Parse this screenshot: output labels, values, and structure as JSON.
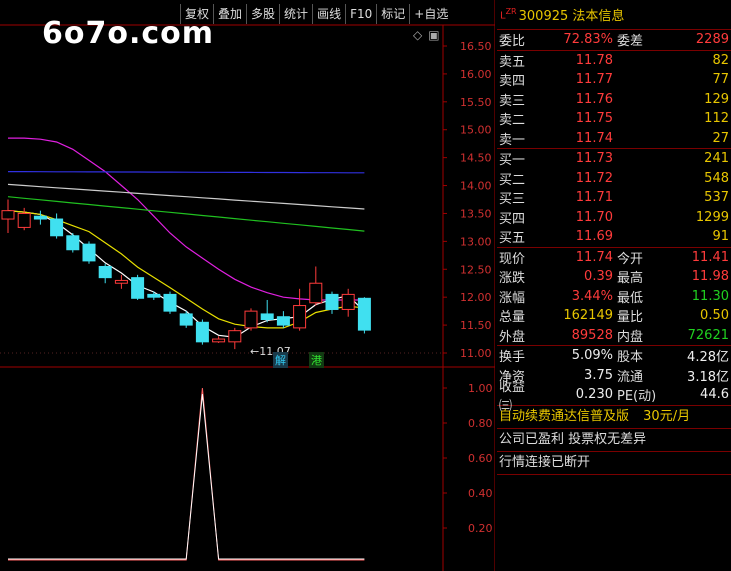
{
  "toolbar": {
    "buttons": [
      "复权",
      "叠加",
      "多股",
      "统计",
      "画线",
      "F10",
      "标记",
      "+自选"
    ]
  },
  "watermark": "6o7o.com",
  "chart": {
    "price_axis": [
      "16.50",
      "16.00",
      "15.50",
      "15.00",
      "14.50",
      "14.00",
      "13.50",
      "13.00",
      "12.50",
      "12.00",
      "11.50",
      "11.00"
    ],
    "indicator_axis": [
      "1.00",
      "0.80",
      "0.60",
      "0.40",
      "0.20"
    ],
    "low_marker": "←11.07",
    "tag_jie": "解",
    "tag_gang": "港"
  },
  "chart_data": {
    "type": "candlestick",
    "ylim": [
      10.9,
      16.6
    ],
    "candles": [
      {
        "o": 13.4,
        "c": 13.55,
        "h": 13.75,
        "l": 13.15
      },
      {
        "o": 13.25,
        "c": 13.5,
        "h": 13.6,
        "l": 13.2
      },
      {
        "o": 13.45,
        "c": 13.4,
        "h": 13.55,
        "l": 13.3
      },
      {
        "o": 13.4,
        "c": 13.1,
        "h": 13.5,
        "l": 13.05
      },
      {
        "o": 13.1,
        "c": 12.85,
        "h": 13.15,
        "l": 12.8
      },
      {
        "o": 12.95,
        "c": 12.65,
        "h": 13.0,
        "l": 12.6
      },
      {
        "o": 12.55,
        "c": 12.35,
        "h": 12.6,
        "l": 12.25
      },
      {
        "o": 12.25,
        "c": 12.3,
        "h": 12.4,
        "l": 12.15
      },
      {
        "o": 12.35,
        "c": 11.98,
        "h": 12.4,
        "l": 11.95
      },
      {
        "o": 12.05,
        "c": 12.0,
        "h": 12.1,
        "l": 11.95
      },
      {
        "o": 12.05,
        "c": 11.75,
        "h": 12.1,
        "l": 11.7
      },
      {
        "o": 11.7,
        "c": 11.5,
        "h": 11.75,
        "l": 11.45
      },
      {
        "o": 11.55,
        "c": 11.2,
        "h": 11.6,
        "l": 11.15
      },
      {
        "o": 11.2,
        "c": 11.25,
        "h": 11.3,
        "l": 11.18
      },
      {
        "o": 11.2,
        "c": 11.4,
        "h": 11.45,
        "l": 11.07
      },
      {
        "o": 11.45,
        "c": 11.75,
        "h": 11.8,
        "l": 11.4
      },
      {
        "o": 11.7,
        "c": 11.6,
        "h": 11.95,
        "l": 11.55
      },
      {
        "o": 11.65,
        "c": 11.5,
        "h": 11.75,
        "l": 11.45
      },
      {
        "o": 11.45,
        "c": 11.85,
        "h": 12.15,
        "l": 11.4
      },
      {
        "o": 11.9,
        "c": 12.25,
        "h": 12.55,
        "l": 11.85
      },
      {
        "o": 12.05,
        "c": 11.78,
        "h": 12.1,
        "l": 11.7
      },
      {
        "o": 11.78,
        "c": 12.05,
        "h": 12.15,
        "l": 11.65
      },
      {
        "o": 11.98,
        "c": 11.41,
        "h": 12.0,
        "l": 11.35
      }
    ],
    "indicator": [
      0,
      0,
      0,
      0,
      0,
      0,
      0,
      0,
      0,
      0,
      0,
      0,
      1,
      0,
      0,
      0,
      0,
      0,
      0,
      0,
      0,
      0,
      0
    ]
  },
  "quote": {
    "header_badge": "L",
    "header_badge_sup": "ZR",
    "code_name": "300925 法本信息",
    "weibi": {
      "label": "委比",
      "value": "72.83%",
      "label2": "委差",
      "value2": "2289"
    },
    "sell": [
      {
        "label": "卖五",
        "price": "11.78",
        "vol": "82"
      },
      {
        "label": "卖四",
        "price": "11.77",
        "vol": "77"
      },
      {
        "label": "卖三",
        "price": "11.76",
        "vol": "129"
      },
      {
        "label": "卖二",
        "price": "11.75",
        "vol": "112"
      },
      {
        "label": "卖一",
        "price": "11.74",
        "vol": "27"
      }
    ],
    "buy": [
      {
        "label": "买一",
        "price": "11.73",
        "vol": "241"
      },
      {
        "label": "买二",
        "price": "11.72",
        "vol": "548"
      },
      {
        "label": "买三",
        "price": "11.71",
        "vol": "537"
      },
      {
        "label": "买四",
        "price": "11.70",
        "vol": "1299"
      },
      {
        "label": "买五",
        "price": "11.69",
        "vol": "91"
      }
    ],
    "stats": [
      {
        "label": "现价",
        "value": "11.74",
        "label2": "今开",
        "value2": "11.41"
      },
      {
        "label": "涨跌",
        "value": "0.39",
        "label2": "最高",
        "value2": "11.98"
      },
      {
        "label": "涨幅",
        "value": "3.44%",
        "label2": "最低",
        "value2": "11.30"
      },
      {
        "label": "总量",
        "value": "162149",
        "label2": "量比",
        "value2": "0.50"
      },
      {
        "label": "外盘",
        "value": "89528",
        "label2": "内盘",
        "value2": "72621"
      }
    ],
    "fin": [
      {
        "label": "换手",
        "value": "5.09%",
        "label2": "股本",
        "value2": "4.28亿"
      },
      {
        "label": "净资",
        "value": "3.75",
        "label2": "流通",
        "value2": "3.18亿"
      },
      {
        "label": "收益㈢",
        "value": "0.230",
        "label2": "PE(动)",
        "value2": "44.6"
      }
    ],
    "promo_text": "自动续费通达信普及版",
    "promo_price": "30元/月",
    "notice1": "公司已盈利 投票权无差异",
    "notice2": "行情连接已断开"
  }
}
